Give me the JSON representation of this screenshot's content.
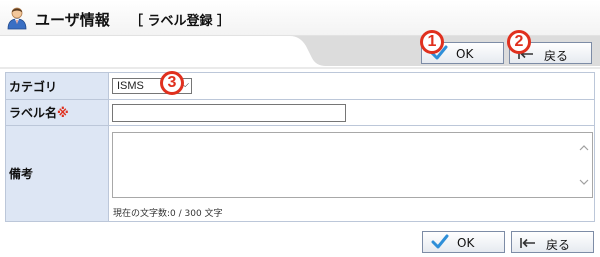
{
  "header": {
    "title": "ユーザ情報",
    "subtitle": "［ ラベル登録 ］"
  },
  "toolbar": {
    "ok_label": "OK",
    "back_label": "戻る"
  },
  "callouts": [
    "1",
    "2",
    "3"
  ],
  "form": {
    "category_label": "カテゴリ",
    "category_value": "ISMS",
    "label_name_label": "ラベル名",
    "required_mark": "※",
    "label_name_value": "",
    "notes_label": "備考",
    "notes_value": "",
    "char_count": "現在の文字数:0 / 300 文字"
  },
  "footer": {
    "ok_label": "OK",
    "back_label": "戻る"
  },
  "colors": {
    "callout": "#e0301e",
    "label_cell": "#dde6f4",
    "border": "#bcc7d9",
    "check": "#2f8fd8"
  }
}
